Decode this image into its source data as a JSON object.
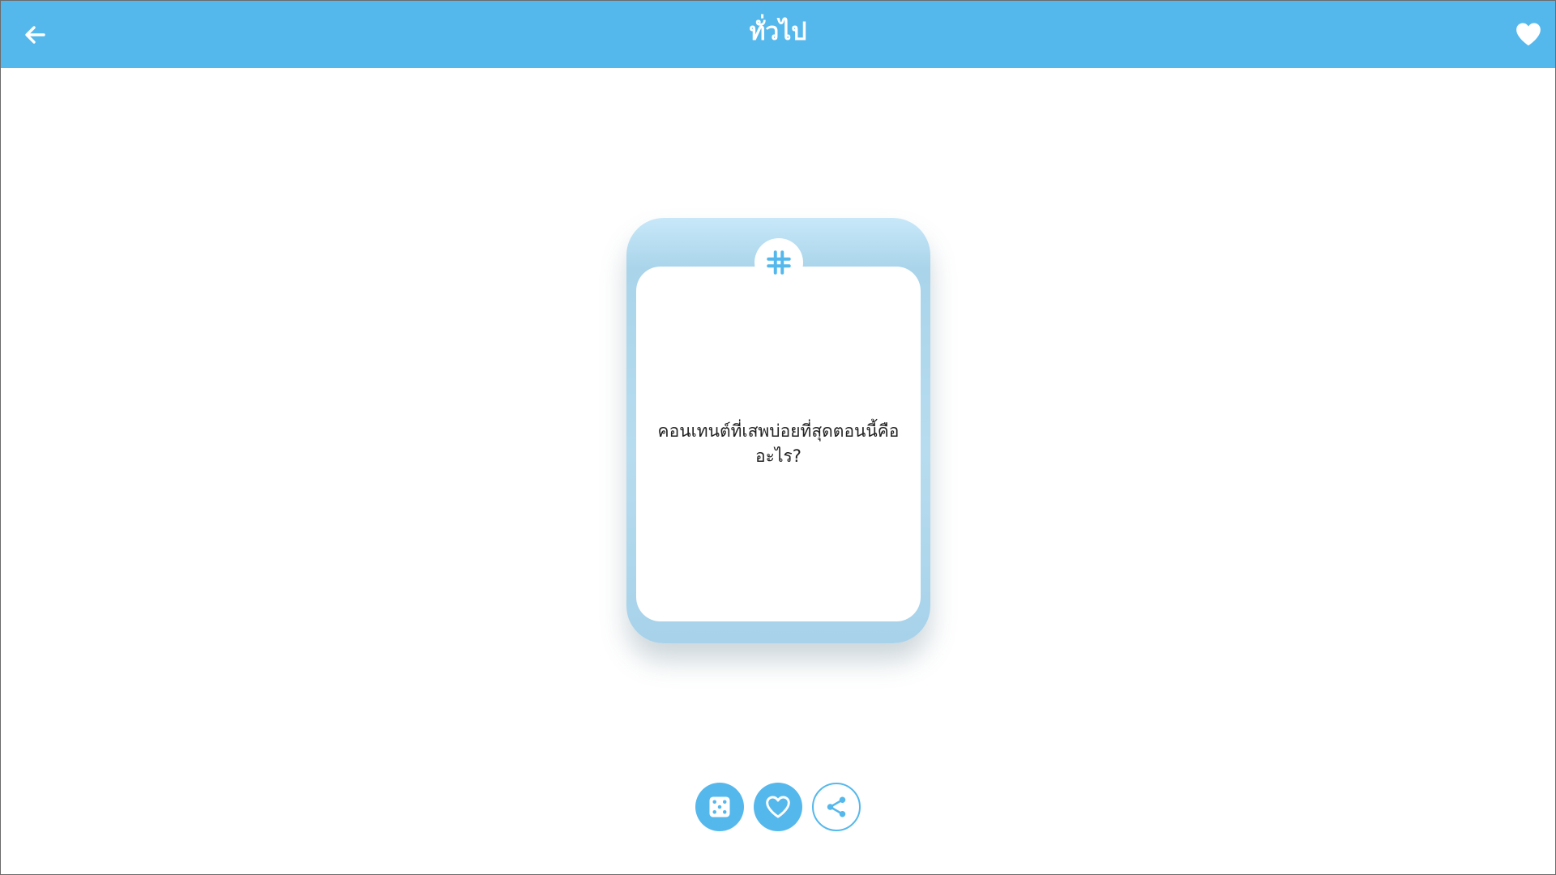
{
  "header": {
    "title": "ทั่วไป",
    "back_icon": "arrow-left-icon",
    "favorite_icon": "heart-filled-icon"
  },
  "card": {
    "badge_icon": "hashtag-icon",
    "question": "คอนเทนต์ที่เสพบ่อยที่สุดตอนนี้คืออะไร?"
  },
  "actions": [
    {
      "name": "random",
      "icon": "dice-icon"
    },
    {
      "name": "favorite",
      "icon": "heart-outline-icon"
    },
    {
      "name": "share",
      "icon": "share-icon"
    }
  ],
  "colors": {
    "accent": "#55b8ec",
    "card_frame": "#b7dcef",
    "text": "#222222",
    "background": "#ffffff"
  }
}
